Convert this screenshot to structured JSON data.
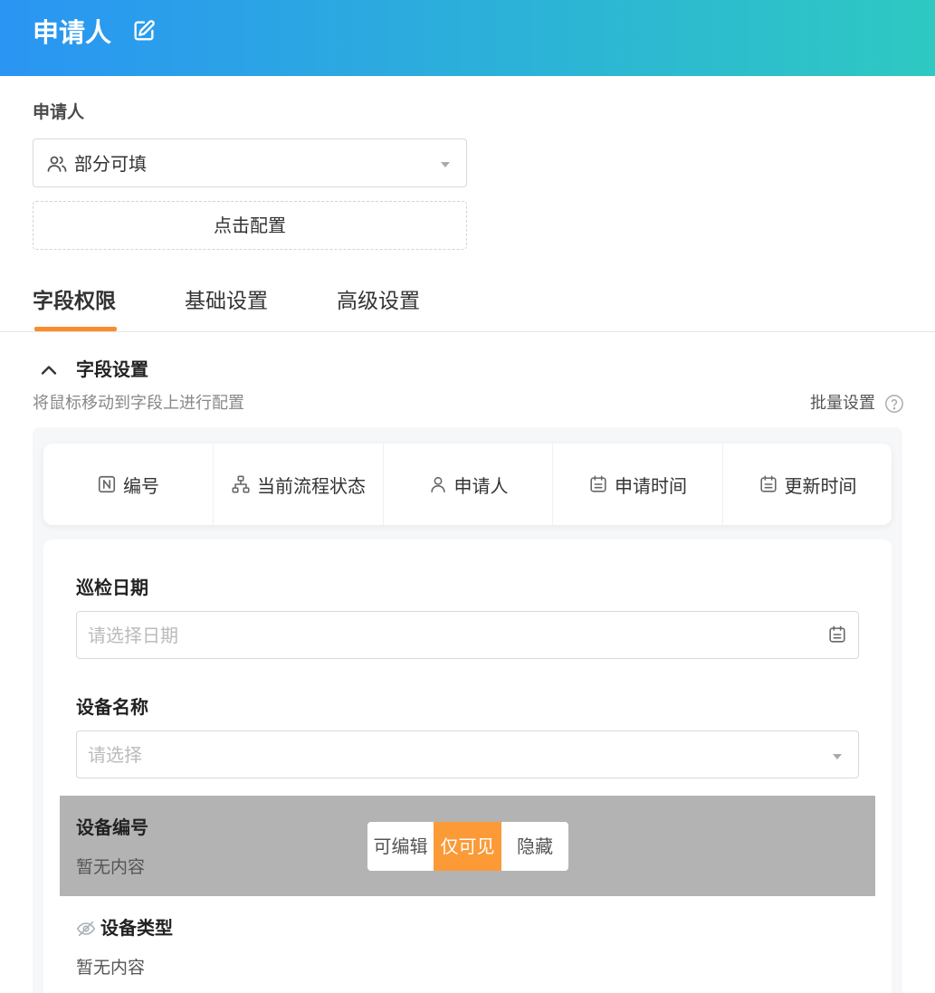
{
  "header": {
    "title": "申请人"
  },
  "applicant": {
    "label": "申请人",
    "select_value": "部分可填",
    "config_button": "点击配置"
  },
  "tabs": [
    {
      "label": "字段权限",
      "active": true
    },
    {
      "label": "基础设置",
      "active": false
    },
    {
      "label": "高级设置",
      "active": false
    }
  ],
  "field_settings": {
    "title": "字段设置",
    "hint": "将鼠标移动到字段上进行配置",
    "batch_label": "批量设置"
  },
  "system_fields": [
    {
      "label": "编号",
      "icon": "number-icon"
    },
    {
      "label": "当前流程状态",
      "icon": "flow-icon"
    },
    {
      "label": "申请人",
      "icon": "user-icon"
    },
    {
      "label": "申请时间",
      "icon": "calendar-icon"
    },
    {
      "label": "更新时间",
      "icon": "calendar-icon"
    }
  ],
  "form_fields": [
    {
      "label": "巡检日期",
      "placeholder": "请选择日期",
      "type": "date"
    },
    {
      "label": "设备名称",
      "placeholder": "请选择",
      "type": "select"
    },
    {
      "label": "设备编号",
      "value": "暂无内容",
      "type": "text"
    },
    {
      "label": "设备类型",
      "value": "暂无内容",
      "type": "text",
      "hidden": true
    }
  ],
  "permission_options": [
    {
      "label": "可编辑",
      "active": false
    },
    {
      "label": "仅可见",
      "active": true
    },
    {
      "label": "隐藏",
      "active": false
    }
  ],
  "colors": {
    "header_start": "#2a95f3",
    "header_end": "#2ec9c2",
    "accent": "#fb8c2c",
    "permission_active": "#fb9a37"
  }
}
